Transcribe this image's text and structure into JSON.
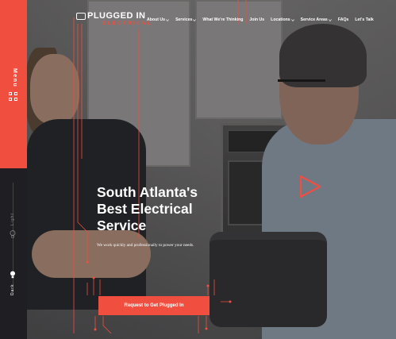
{
  "brand": {
    "name": "PLUGGED IN",
    "tagline": "ELECTRICAL",
    "accent_color": "#f04e3f",
    "logo_icon": "plug-icon"
  },
  "sidebar": {
    "menu_label": "Menu",
    "menu_icon": "grid-icon",
    "light_label": "Light",
    "dark_label": "Dark",
    "light_icon": "bulb-outline-icon",
    "dark_icon": "bulb-filled-icon"
  },
  "nav": {
    "items": [
      {
        "label": "About Us",
        "dropdown": true
      },
      {
        "label": "Services",
        "dropdown": true
      },
      {
        "label": "What We're Thinking",
        "dropdown": false
      },
      {
        "label": "Join Us",
        "dropdown": false
      },
      {
        "label": "Locations",
        "dropdown": true
      },
      {
        "label": "Service Areas",
        "dropdown": true
      },
      {
        "label": "FAQs",
        "dropdown": false
      },
      {
        "label": "Let's Talk",
        "dropdown": false
      }
    ]
  },
  "hero": {
    "headline_line1": "South Atlanta's",
    "headline_line2": "Best Electrical",
    "headline_line3": "Service",
    "subtitle": "We work quickly and professionally to power your needs.",
    "cta_label": "Request to Get Plugged In",
    "play_icon": "play-icon"
  }
}
